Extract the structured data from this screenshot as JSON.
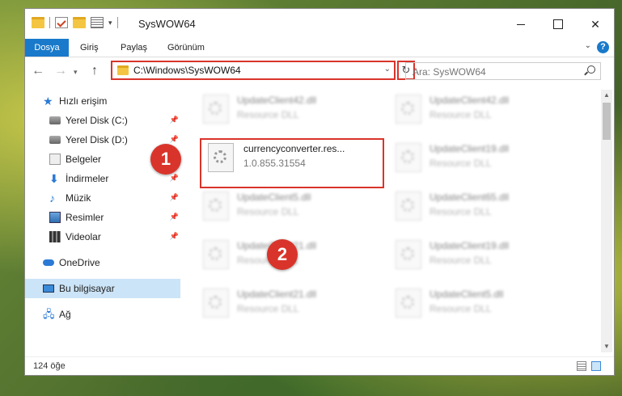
{
  "window": {
    "title": "SysWOW64",
    "controls": {
      "minimize": "—",
      "maximize": "☐",
      "close": "✕"
    }
  },
  "ribbon": {
    "tabs": [
      "Dosya",
      "Giriş",
      "Paylaş",
      "Görünüm"
    ],
    "help": "?"
  },
  "nav": {
    "address": "C:\\Windows\\SysWOW64",
    "search_placeholder": "Ara: SysWOW64"
  },
  "sidebar": {
    "quick_access": "Hızlı erişim",
    "items": [
      {
        "label": "Yerel Disk (C:)",
        "icon": "disk-icon",
        "pinned": true
      },
      {
        "label": "Yerel Disk (D:)",
        "icon": "disk-icon",
        "pinned": true
      },
      {
        "label": "Belgeler",
        "icon": "documents-icon",
        "pinned": true
      },
      {
        "label": "İndirmeler",
        "icon": "download-icon",
        "pinned": true
      },
      {
        "label": "Müzik",
        "icon": "music-icon",
        "pinned": true
      },
      {
        "label": "Resimler",
        "icon": "pictures-icon",
        "pinned": true
      },
      {
        "label": "Videolar",
        "icon": "video-icon",
        "pinned": true
      }
    ],
    "onedrive": "OneDrive",
    "this_pc": "Bu bilgisayar",
    "network": "Ağ"
  },
  "files": {
    "left": [
      {
        "name": "UpdateClient42.dll",
        "desc": "Resource DLL",
        "blurred": true
      },
      {
        "name": "currencyconverter.res...",
        "desc": "1.0.855.31554",
        "blurred": false,
        "highlight": true
      },
      {
        "name": "UpdateClient5.dll",
        "desc": "Resource DLL",
        "blurred": true
      },
      {
        "name": "UpdateClient21.dll",
        "desc": "Resource DLL",
        "blurred": true
      },
      {
        "name": "UpdateClient21.dll",
        "desc": "Resource DLL",
        "blurred": true
      }
    ],
    "right": [
      {
        "name": "UpdateClient42.dll",
        "desc": "Resource DLL",
        "blurred": true
      },
      {
        "name": "UpdateClient19.dll",
        "desc": "Resource DLL",
        "blurred": true
      },
      {
        "name": "UpdateClient65.dll",
        "desc": "Resource DLL",
        "blurred": true
      },
      {
        "name": "UpdateClient19.dll",
        "desc": "Resource DLL",
        "blurred": true
      },
      {
        "name": "UpdateClient5.dll",
        "desc": "Resource DLL",
        "blurred": true
      }
    ]
  },
  "status": {
    "count": "124 öğe"
  },
  "callouts": {
    "one": "1",
    "two": "2"
  },
  "colors": {
    "accent": "#1979ca",
    "highlight": "#d9342b",
    "selected": "#cce4f7"
  }
}
